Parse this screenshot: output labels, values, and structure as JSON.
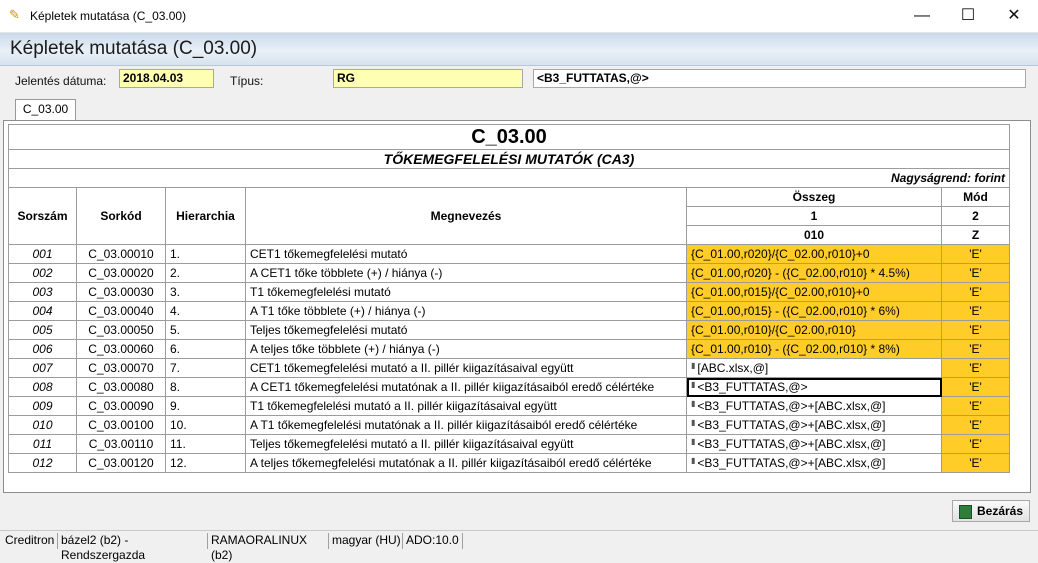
{
  "window": {
    "title": "Képletek mutatása (C_03.00)",
    "min": "—",
    "max": "☐",
    "close": "✕"
  },
  "header": {
    "title": "Képletek mutatása (C_03.00)"
  },
  "form": {
    "date_label": "Jelentés dátuma:",
    "date_value": "2018.04.03",
    "type_label": "Típus:",
    "type_value": "RG",
    "expr_value": "<B3_FUTTATAS,@>"
  },
  "tab": {
    "label": "C_03.00"
  },
  "report": {
    "code": "C_03.00",
    "title": "TŐKEMEGFELELÉSI MUTATÓK (CA3)",
    "unit": "Nagyságrend: forint",
    "headers": {
      "sorszam": "Sorszám",
      "sorkod": "Sorkód",
      "hierarchia": "Hierarchia",
      "megnevezes": "Megnevezés",
      "osszeg": "Összeg",
      "mod": "Mód",
      "col1": "1",
      "col2": "2",
      "code1": "010",
      "code2": "Z"
    },
    "rows": [
      {
        "no": "001",
        "code": "C_03.00010",
        "hier": "1.",
        "name": "CET1 tőkemegfelelési mutató",
        "formula": "{C_01.00,r020}/{C_02.00,r010}+0",
        "mod": "'E'",
        "orange": true,
        "mark": false
      },
      {
        "no": "002",
        "code": "C_03.00020",
        "hier": "2.",
        "name": "A CET1 tőke többlete (+) / hiánya (-)",
        "formula": "{C_01.00,r020} - ({C_02.00,r010} * 4.5%)",
        "mod": "'E'",
        "orange": true,
        "mark": false
      },
      {
        "no": "003",
        "code": "C_03.00030",
        "hier": "3.",
        "name": "T1 tőkemegfelelési mutató",
        "formula": "{C_01.00,r015}/{C_02.00,r010}+0",
        "mod": "'E'",
        "orange": true,
        "mark": false
      },
      {
        "no": "004",
        "code": "C_03.00040",
        "hier": "4.",
        "name": "A T1 tőke többlete (+) / hiánya (-)",
        "formula": "{C_01.00,r015} - ({C_02.00,r010} * 6%)",
        "mod": "'E'",
        "orange": true,
        "mark": false
      },
      {
        "no": "005",
        "code": "C_03.00050",
        "hier": "5.",
        "name": "Teljes tőkemegfelelési mutató",
        "formula": "{C_01.00,r010}/{C_02.00,r010}",
        "mod": "'E'",
        "orange": true,
        "mark": false
      },
      {
        "no": "006",
        "code": "C_03.00060",
        "hier": "6.",
        "name": "A teljes tőke többlete (+) / hiánya (-)",
        "formula": "{C_01.00,r010} - ({C_02.00,r010} * 8%)",
        "mod": "'E'",
        "orange": true,
        "mark": false
      },
      {
        "no": "007",
        "code": "C_03.00070",
        "hier": "7.",
        "name": "CET1 tőkemegfelelési mutató a II. pillér kiigazításaival együtt",
        "formula": "[ABC.xlsx,@]",
        "mod": "'E'",
        "orange": false,
        "mark": true
      },
      {
        "no": "008",
        "code": "C_03.00080",
        "hier": "8.",
        "name": "A CET1 tőkemegfelelési mutatónak a II. pillér kiigazításaiból eredő célértéke",
        "formula": "<B3_FUTTATAS,@>",
        "mod": "'E'",
        "orange": false,
        "mark": true,
        "selected": true
      },
      {
        "no": "009",
        "code": "C_03.00090",
        "hier": "9.",
        "name": "T1 tőkemegfelelési mutató a II. pillér kiigazításaival együtt",
        "formula": "<B3_FUTTATAS,@>+[ABC.xlsx,@]",
        "mod": "'E'",
        "orange": false,
        "mark": true
      },
      {
        "no": "010",
        "code": "C_03.00100",
        "hier": "10.",
        "name": "A T1 tőkemegfelelési mutatónak a II. pillér kiigazításaiból eredő célértéke",
        "formula": "<B3_FUTTATAS,@>+[ABC.xlsx,@]",
        "mod": "'E'",
        "orange": false,
        "mark": true
      },
      {
        "no": "011",
        "code": "C_03.00110",
        "hier": "11.",
        "name": "Teljes tőkemegfelelési mutató a II. pillér kiigazításaival együtt",
        "formula": "<B3_FUTTATAS,@>+[ABC.xlsx,@]",
        "mod": "'E'",
        "orange": false,
        "mark": true
      },
      {
        "no": "012",
        "code": "C_03.00120",
        "hier": "12.",
        "name": "A teljes tőkemegfelelési mutatónak a II. pillér kiigazításaiból eredő célértéke",
        "formula": "<B3_FUTTATAS,@>+[ABC.xlsx,@]",
        "mod": "'E'",
        "orange": false,
        "mark": true
      }
    ]
  },
  "close_button": {
    "label": "Bezárás"
  },
  "status": [
    "Creditron",
    "bázel2 (b2) - Rendszergazda",
    "RAMAORALINUX (b2)",
    "magyar (HU)",
    "ADO:10.0"
  ],
  "colors": {
    "accent": "#ffcc28",
    "input_yellow": "#ffffb4"
  }
}
